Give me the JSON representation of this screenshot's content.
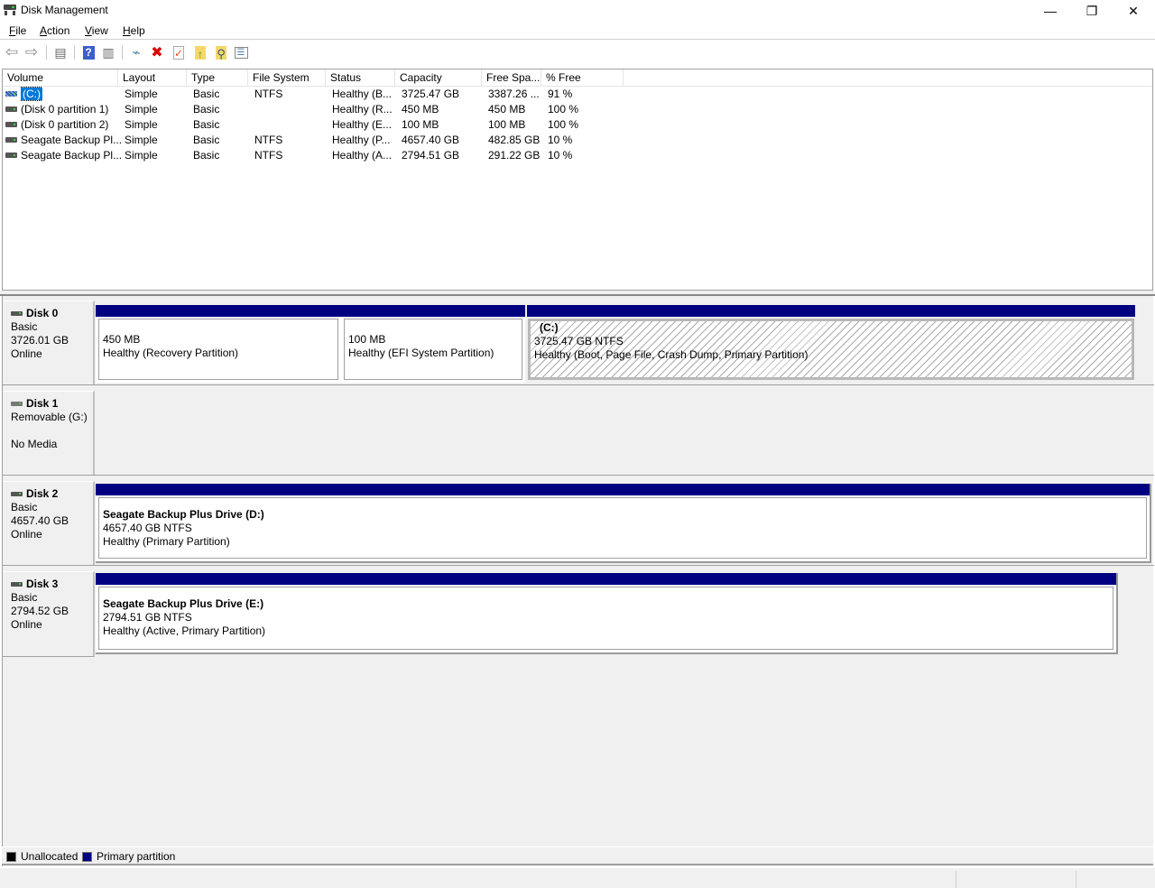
{
  "window": {
    "title": "Disk Management",
    "controls": {
      "minimize": "—",
      "restore": "❐",
      "close": "✕"
    }
  },
  "menu": [
    {
      "label": "File",
      "accel": "F"
    },
    {
      "label": "Action",
      "accel": "A"
    },
    {
      "label": "View",
      "accel": "V"
    },
    {
      "label": "Help",
      "accel": "H"
    }
  ],
  "toolbar": [
    {
      "name": "back-icon",
      "glyph": "⇦"
    },
    {
      "name": "forward-icon",
      "glyph": "⇨"
    },
    {
      "name": "show-hide-console-tree-icon",
      "glyph": "▤"
    },
    {
      "name": "help-icon",
      "glyph": "?"
    },
    {
      "name": "show-hide-action-pane-icon",
      "glyph": "▥"
    },
    {
      "name": "connect-virtual-disk-icon",
      "glyph": "⌁"
    },
    {
      "name": "delete-icon",
      "glyph": "✖"
    },
    {
      "name": "properties-icon",
      "glyph": "✓"
    },
    {
      "name": "open-folder-up-icon",
      "glyph": "↑"
    },
    {
      "name": "explore-search-icon",
      "glyph": "⚲"
    },
    {
      "name": "settings-list-icon",
      "glyph": "☰"
    }
  ],
  "volume_list": {
    "columns": [
      "Volume",
      "Layout",
      "Type",
      "File System",
      "Status",
      "Capacity",
      "Free Spa...",
      "% Free"
    ],
    "rows": [
      {
        "volume": "(C:)",
        "layout": "Simple",
        "type": "Basic",
        "fs": "NTFS",
        "status": "Healthy (B...",
        "capacity": "3725.47 GB",
        "free": "3387.26 ...",
        "pct": "91 %",
        "selected": true
      },
      {
        "volume": "(Disk 0 partition 1)",
        "layout": "Simple",
        "type": "Basic",
        "fs": "",
        "status": "Healthy (R...",
        "capacity": "450 MB",
        "free": "450 MB",
        "pct": "100 %"
      },
      {
        "volume": "(Disk 0 partition 2)",
        "layout": "Simple",
        "type": "Basic",
        "fs": "",
        "status": "Healthy (E...",
        "capacity": "100 MB",
        "free": "100 MB",
        "pct": "100 %"
      },
      {
        "volume": "Seagate Backup Pl...",
        "layout": "Simple",
        "type": "Basic",
        "fs": "NTFS",
        "status": "Healthy (P...",
        "capacity": "4657.40 GB",
        "free": "482.85 GB",
        "pct": "10 %"
      },
      {
        "volume": "Seagate Backup Pl...",
        "layout": "Simple",
        "type": "Basic",
        "fs": "NTFS",
        "status": "Healthy (A...",
        "capacity": "2794.51 GB",
        "free": "291.22 GB",
        "pct": "10 %"
      }
    ]
  },
  "disks": [
    {
      "name": "Disk 0",
      "line1": "Basic",
      "line2": "3726.01 GB",
      "line3": "Online",
      "partitions": [
        {
          "title": "",
          "size": "450 MB",
          "status": "Healthy (Recovery Partition)"
        },
        {
          "title": "",
          "size": "100 MB",
          "status": "Healthy (EFI System Partition)"
        },
        {
          "title": "(C:)",
          "size": "3725.47 GB NTFS",
          "status": "Healthy (Boot, Page File, Crash Dump, Primary Partition)",
          "selected": true
        }
      ]
    },
    {
      "name": "Disk 1",
      "line1": "Removable (G:)",
      "line2": "",
      "line3": "No Media",
      "partitions": []
    },
    {
      "name": "Disk 2",
      "line1": "Basic",
      "line2": "4657.40 GB",
      "line3": "Online",
      "partitions": [
        {
          "title": "Seagate Backup Plus Drive  (D:)",
          "size": "4657.40 GB NTFS",
          "status": "Healthy (Primary Partition)"
        }
      ]
    },
    {
      "name": "Disk 3",
      "line1": "Basic",
      "line2": "2794.52 GB",
      "line3": "Online",
      "partitions": [
        {
          "title": "Seagate Backup Plus Drive  (E:)",
          "size": "2794.51 GB NTFS",
          "status": "Healthy (Active, Primary Partition)"
        }
      ]
    }
  ],
  "legend": [
    {
      "label": "Unallocated",
      "color": "#000000"
    },
    {
      "label": "Primary partition",
      "color": "#000080"
    }
  ],
  "colors": {
    "primary_partition": "#000080",
    "selection": "#0078d7"
  }
}
